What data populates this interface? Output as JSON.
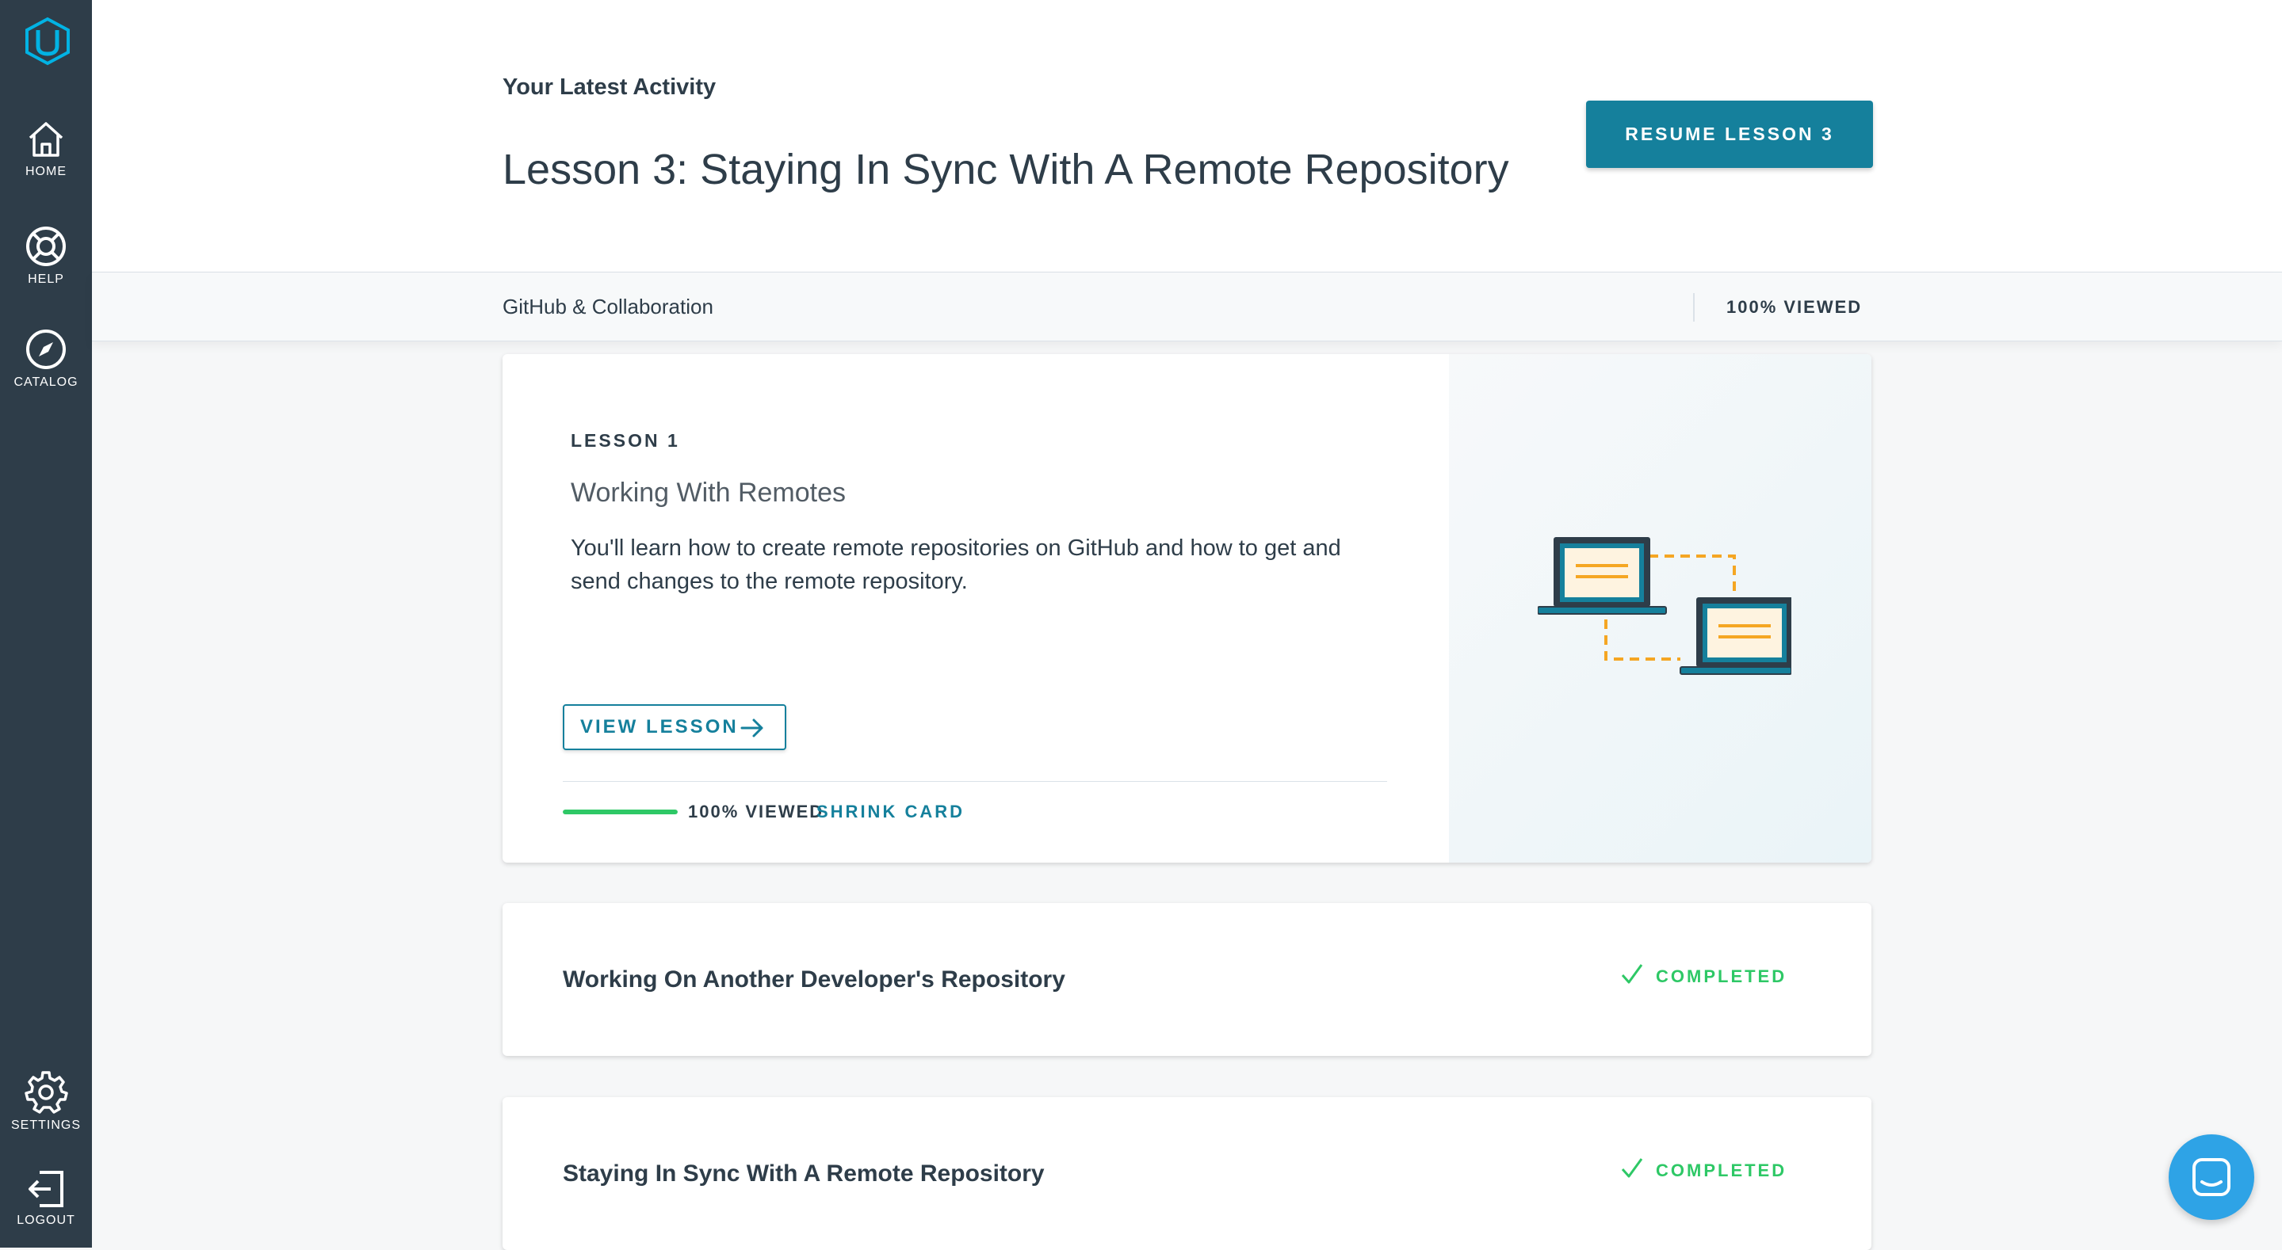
{
  "sidebar": {
    "logo_icon": "udacity-logo-icon",
    "items": [
      {
        "label": "HOME",
        "icon": "home-icon"
      },
      {
        "label": "HELP",
        "icon": "lifebuoy-icon"
      },
      {
        "label": "CATALOG",
        "icon": "compass-icon"
      },
      {
        "label": "SETTINGS",
        "icon": "gear-icon"
      },
      {
        "label": "LOGOUT",
        "icon": "logout-icon"
      }
    ]
  },
  "header": {
    "latest_label": "Your Latest Activity",
    "lesson_title": "Lesson 3: Staying In Sync With A Remote Repository",
    "resume_label": "RESUME LESSON 3"
  },
  "subbar": {
    "course_name": "GitHub & Collaboration",
    "progress_label": "100% VIEWED"
  },
  "lessons": [
    {
      "number_label": "LESSON 1",
      "title": "Working With Remotes",
      "description": "You'll learn how to create remote repositories on GitHub and how to get and send changes to the remote repository.",
      "view_label": "VIEW LESSON",
      "progress": 1.0,
      "progress_label": "100% VIEWED",
      "shrink_label": "SHRINK CARD",
      "illustration_icon": "two-laptops-sync-icon"
    },
    {
      "title": "Working On Another Developer's Repository",
      "status": "COMPLETED"
    },
    {
      "title": "Staying In Sync With A Remote Repository",
      "status": "COMPLETED"
    }
  ],
  "colors": {
    "sidebar": "#2e3d49",
    "primary": "#15809c",
    "success": "#2ec866",
    "accent_orange": "#f5a623",
    "chat": "#2ea3e6"
  },
  "chat": {
    "icon": "chat-icon"
  }
}
